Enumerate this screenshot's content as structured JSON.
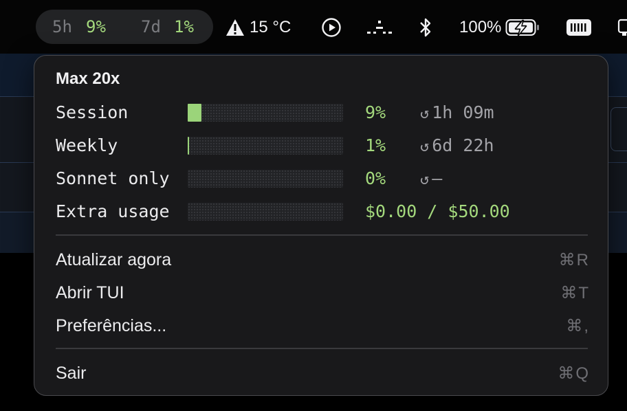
{
  "menubar": {
    "usage_pill": {
      "five_hour_label": "5h",
      "five_hour_value": "9%",
      "seven_day_label": "7d",
      "seven_day_value": "1%"
    },
    "temperature": "15 °C",
    "battery_percent": "100%",
    "icons": [
      "warning-icon",
      "play-circle-icon",
      "spaces-icon",
      "bluetooth-icon",
      "battery-charging-icon",
      "memory-icon",
      "display-icon"
    ]
  },
  "popup": {
    "plan": "Max 20x",
    "usage_rows": [
      {
        "label": "Session",
        "percent": "9%",
        "fill_percent": 9,
        "reset_icon": "↺",
        "reset": "1h 09m"
      },
      {
        "label": "Weekly",
        "percent": "1%",
        "fill_percent": 1,
        "reset_icon": "↺",
        "reset": "6d 22h"
      },
      {
        "label": "Sonnet only",
        "percent": "0%",
        "fill_percent": 0,
        "reset_icon": "↺",
        "reset": "—"
      },
      {
        "label": "Extra usage",
        "amount": "$0.00 / $50.00",
        "fill_percent": 0
      }
    ],
    "menu": [
      {
        "label": "Atualizar agora",
        "shortcut": "⌘R"
      },
      {
        "label": "Abrir TUI",
        "shortcut": "⌘T"
      },
      {
        "label": "Preferências...",
        "shortcut": "⌘,"
      }
    ],
    "quit": {
      "label": "Sair",
      "shortcut": "⌘Q"
    }
  },
  "colors": {
    "accent_green": "#a4d97d",
    "bar_fill": "#9bd47a",
    "popup_bg": "#19191b"
  }
}
